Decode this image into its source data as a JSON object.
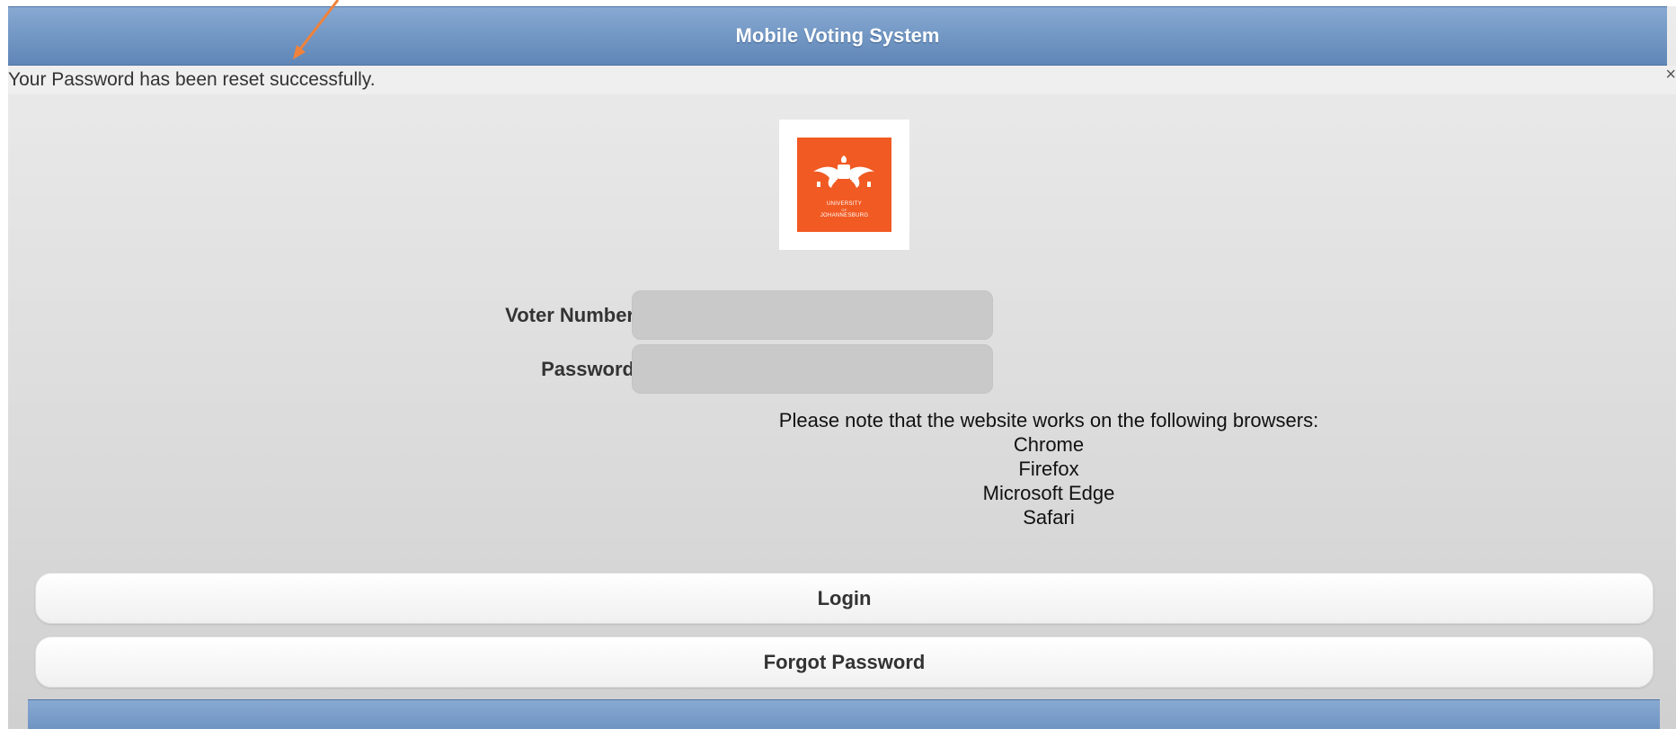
{
  "header": {
    "title": "Mobile Voting System"
  },
  "notice": {
    "message": "Your Password has been reset successfully.",
    "close_glyph": "×"
  },
  "logo": {
    "line1": "UNIVERSITY",
    "line2": "OF",
    "line3": "JOHANNESBURG",
    "color": "#f15a22"
  },
  "form": {
    "voter_number_label": "Voter Number",
    "voter_number_value": "",
    "password_label": "Password",
    "password_value": ""
  },
  "browser_note": {
    "intro": "Please note that the website works on the following browsers:",
    "browsers": [
      "Chrome",
      "Firefox",
      "Microsoft Edge",
      "Safari"
    ]
  },
  "buttons": {
    "login": "Login",
    "forgot_password": "Forgot Password"
  },
  "colors": {
    "header": "#6f94c3",
    "annotation_arrow": "#f0823b"
  }
}
